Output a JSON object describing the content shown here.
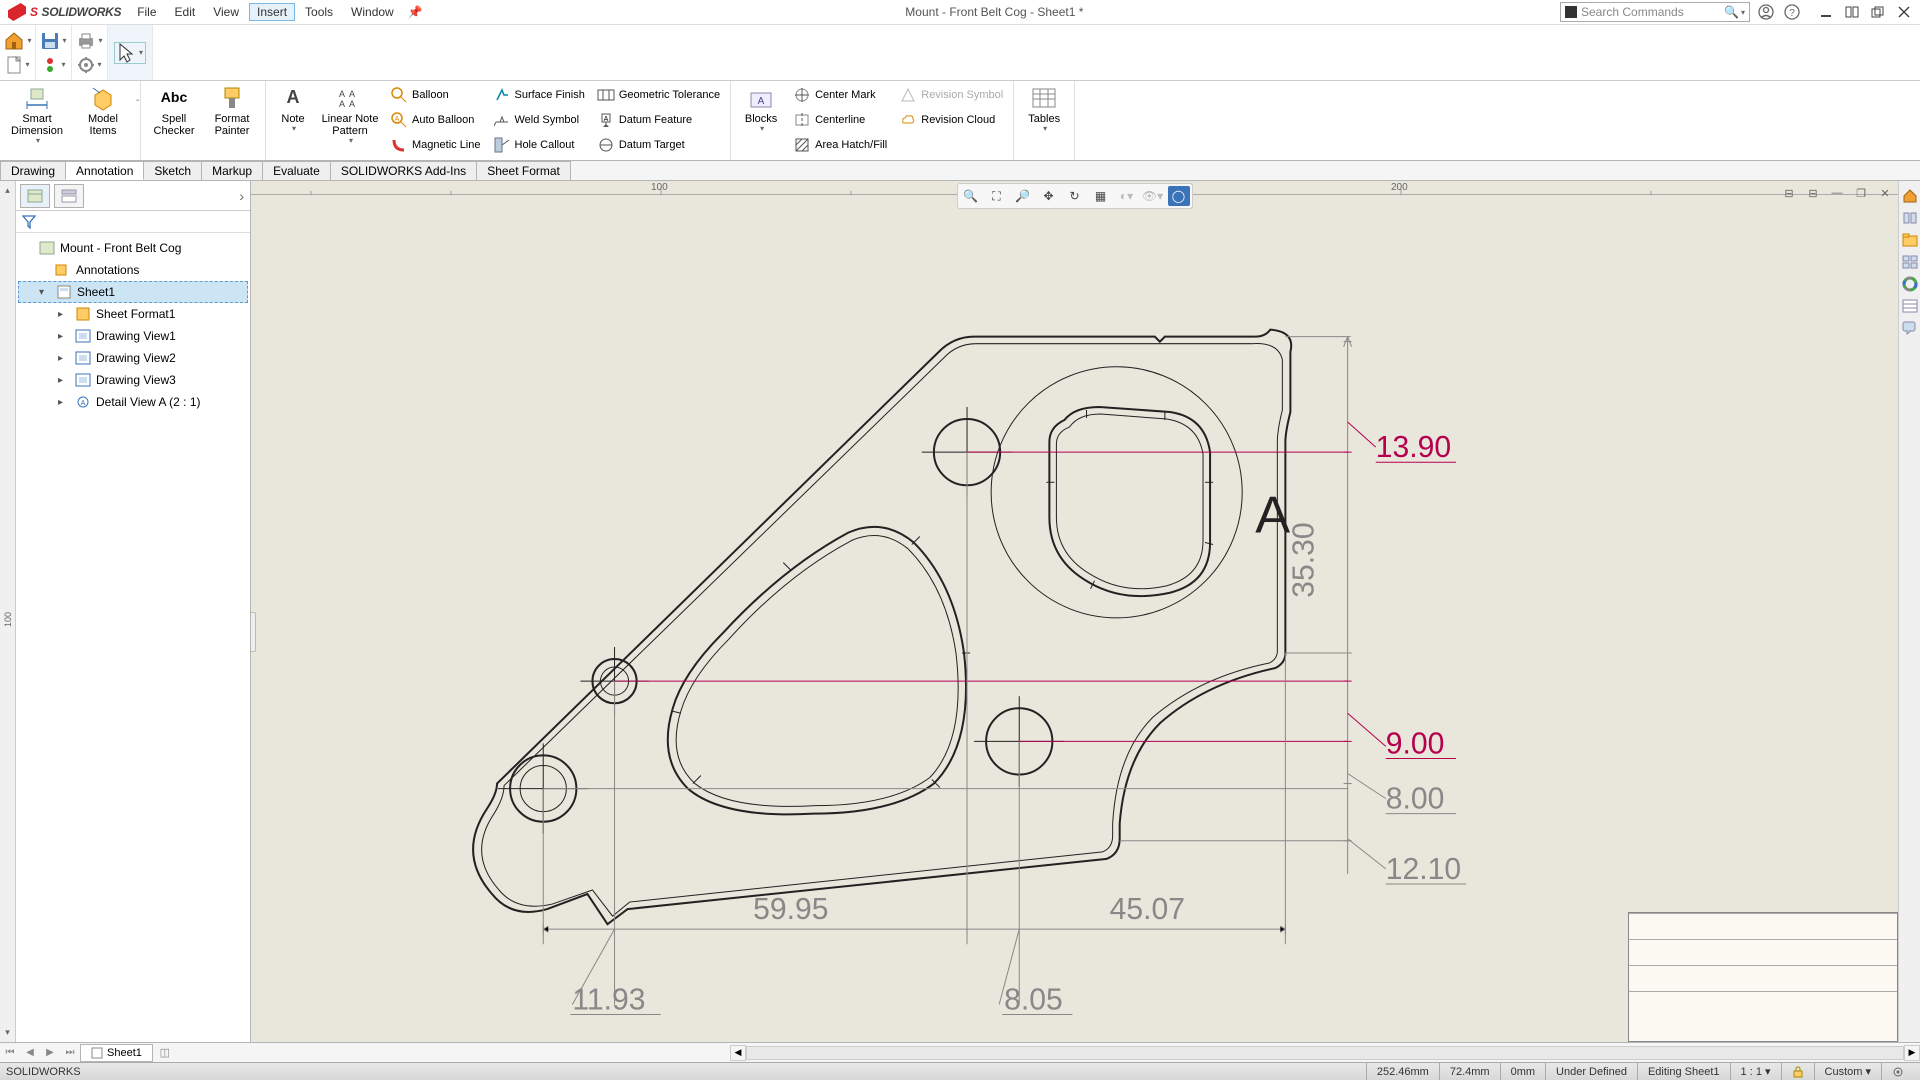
{
  "title": {
    "app": "SOLIDWORKS",
    "doc": "Mount - Front Belt Cog - Sheet1 *"
  },
  "menu": {
    "items": [
      "File",
      "Edit",
      "View",
      "Insert",
      "Tools",
      "Window"
    ],
    "active": "Insert"
  },
  "search": {
    "placeholder": "Search Commands"
  },
  "ribbon": {
    "big": {
      "smart_dimension": "Smart Dimension",
      "model_items": "Model Items",
      "spell_checker": "Spell Checker",
      "format_painter": "Format Painter",
      "note": "Note",
      "linear_note_pattern": "Linear Note Pattern",
      "blocks": "Blocks",
      "tables": "Tables"
    },
    "small": {
      "balloon": "Balloon",
      "auto_balloon": "Auto Balloon",
      "magnetic_line": "Magnetic Line",
      "surface_finish": "Surface Finish",
      "weld_symbol": "Weld Symbol",
      "hole_callout": "Hole Callout",
      "geometric_tolerance": "Geometric Tolerance",
      "datum_feature": "Datum Feature",
      "datum_target": "Datum Target",
      "center_mark": "Center Mark",
      "centerline": "Centerline",
      "area_hatch": "Area Hatch/Fill",
      "revision_symbol": "Revision Symbol",
      "revision_cloud": "Revision Cloud"
    }
  },
  "ribbon_tabs": {
    "items": [
      "Drawing",
      "Annotation",
      "Sketch",
      "Markup",
      "Evaluate",
      "SOLIDWORKS Add-Ins",
      "Sheet Format"
    ],
    "active": "Annotation"
  },
  "ruler": {
    "m100": "100",
    "m200": "200"
  },
  "left_ruler": {
    "m100": "100"
  },
  "tree": {
    "root": "Mount - Front Belt Cog",
    "annotations": "Annotations",
    "sheet": "Sheet1",
    "sheet_format": "Sheet Format1",
    "dv1": "Drawing View1",
    "dv2": "Drawing View2",
    "dv3": "Drawing View3",
    "detail": "Detail View A (2 : 1)"
  },
  "dimensions": {
    "d1390": "13.90",
    "d3530": "35.30",
    "d900": "9.00",
    "d800": "8.00",
    "d1210": "12.10",
    "d5995": "59.95",
    "d4507": "45.07",
    "d1193": "11.93",
    "d805": "8.05",
    "labelA": "A"
  },
  "sheet_tab": {
    "name": "Sheet1"
  },
  "status": {
    "app": "SOLIDWORKS",
    "x": "252.46mm",
    "y": "72.4mm",
    "z": "0mm",
    "state": "Under Defined",
    "editing": "Editing Sheet1",
    "scale": "1 : 1",
    "custom": "Custom"
  }
}
